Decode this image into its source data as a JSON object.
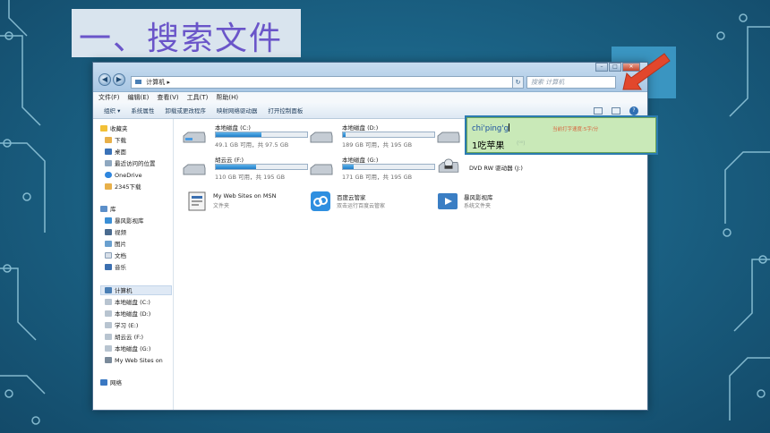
{
  "slide": {
    "title": "一、搜索文件"
  },
  "window": {
    "breadcrumb": "计算机 ▸",
    "search_placeholder": "搜索 计算机",
    "menu": [
      "文件(F)",
      "编辑(E)",
      "查看(V)",
      "工具(T)",
      "帮助(H)"
    ],
    "toolbar": [
      "组织 ▾",
      "系统属性",
      "卸载或更改程序",
      "映射网络驱动器",
      "打开控制面板"
    ],
    "nav": {
      "favorites": [
        "收藏夹",
        "下载",
        "桌面",
        "最近访问的位置",
        "OneDrive",
        "2345下载"
      ],
      "libraries": [
        "库",
        "暴风影视库",
        "视频",
        "图片",
        "文档",
        "音乐"
      ],
      "computer": [
        "计算机",
        "本地磁盘 (C:)",
        "本地磁盘 (D:)",
        "学习 (E:)",
        "胡云云 (F:)",
        "本地磁盘 (G:)",
        "My Web Sites on"
      ],
      "network": "网络"
    },
    "drives": [
      {
        "name": "本地磁盘 (C:)",
        "free": "49.1 GB 可用，共 97.5 GB",
        "used_fraction": 0.5
      },
      {
        "name": "本地磁盘 (D:)",
        "free": "189 GB 可用，共 195 GB",
        "used_fraction": 0.03
      },
      {
        "name": "胡云云 (F:)",
        "free": "110 GB 可用，共 195 GB",
        "used_fraction": 0.44
      },
      {
        "name": "本地磁盘 (G:)",
        "free": "171 GB 可用，共 195 GB",
        "used_fraction": 0.12
      }
    ],
    "dvd": "DVD RW 驱动器 (J:)",
    "entries": [
      {
        "name": "My Web Sites on MSN",
        "sub": "文件夹"
      },
      {
        "name": "百度云管家",
        "sub": "双击运行百度云管家"
      },
      {
        "name": "暴风影视库",
        "sub": "系统文件夹"
      }
    ]
  },
  "ime": {
    "input": "chi'ping'g",
    "tip": "当前打字速度:5字/分",
    "candidate": "1吃苹果",
    "extra": "(⁰⁰)"
  }
}
